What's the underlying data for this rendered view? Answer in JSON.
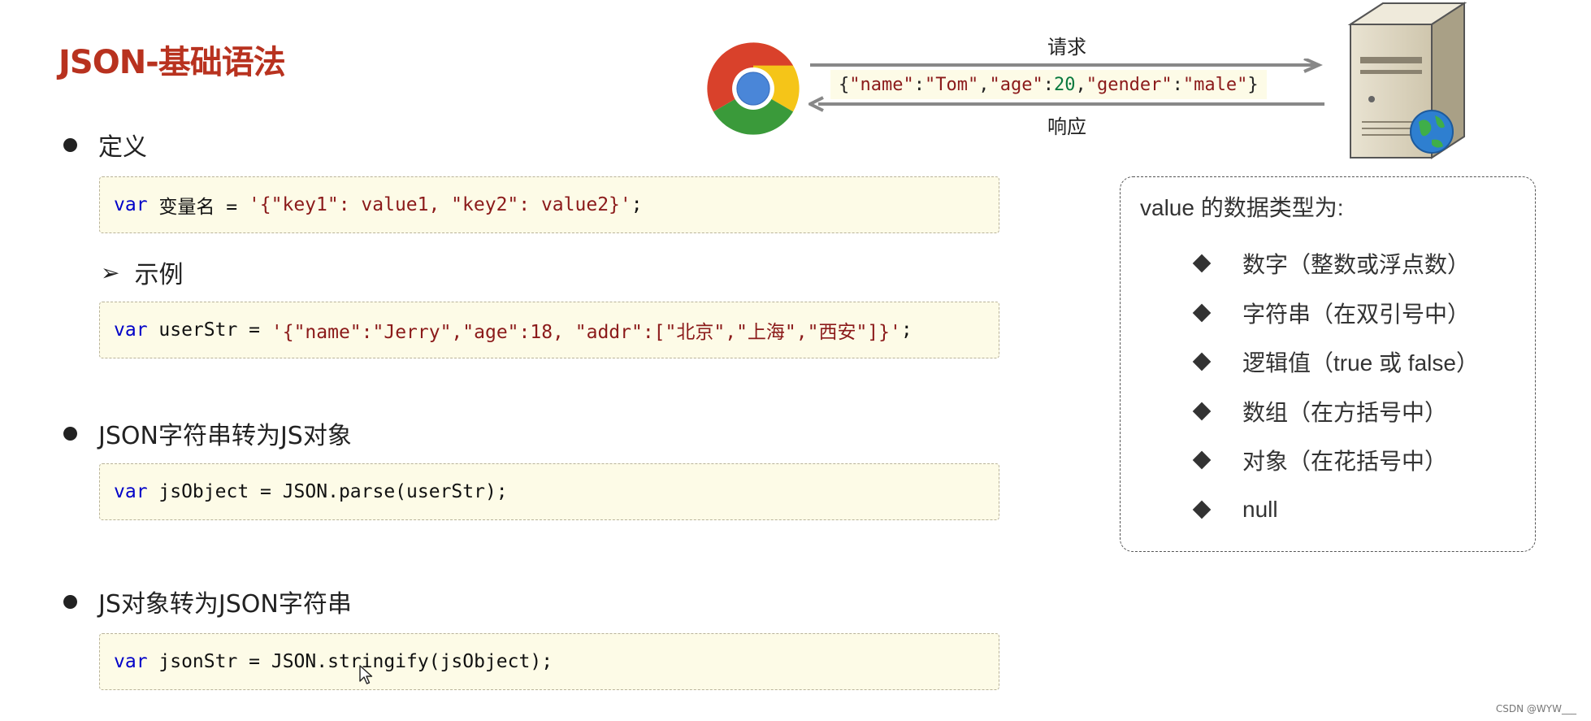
{
  "title": "JSON-基础语法",
  "sections": {
    "definition": "定义",
    "example": "示例",
    "parse": "JSON字符串转为JS对象",
    "stringify": "JS对象转为JSON字符串"
  },
  "code": {
    "definition": {
      "kw": "var",
      "pre": " 变量名 = ",
      "str": "'{\"key1\": value1, \"key2\": value2}'",
      "post": ";"
    },
    "example": {
      "kw": "var",
      "pre": " userStr = ",
      "str1": "'{\"name\":\"Jerry\",\"age\":18, \"addr\":[\"北京\",\"上海\",\"西安\"]}'",
      "post": ";"
    },
    "parse": {
      "kw": "var",
      "rest": " jsObject = JSON.parse(userStr);"
    },
    "stringify": {
      "kw": "var",
      "rest": " jsonStr = JSON.stringify(jsObject);"
    }
  },
  "diagram": {
    "request_label": "请求",
    "response_label": "响应",
    "json_open": "{",
    "json_k1": "\"name\"",
    "json_c1": ":",
    "json_v1": "\"Tom\"",
    "json_sep1": ",",
    "json_k2": "\"age\"",
    "json_c2": ":",
    "json_v2": "20",
    "json_sep2": ",",
    "json_k3": "\"gender\"",
    "json_c3": ":",
    "json_v3": "\"male\"",
    "json_close": "}",
    "colors": {
      "arrow": "#888888",
      "string": "#8b1a1a",
      "number": "#097a3e"
    }
  },
  "value_types": {
    "title": "value 的数据类型为:",
    "items": [
      "数字（整数或浮点数）",
      "字符串（在双引号中）",
      "逻辑值（true 或 false）",
      "数组（在方括号中）",
      "对象（在花括号中）",
      "null"
    ]
  },
  "watermark": "CSDN @WYW___",
  "colors": {
    "title": "#b8321f",
    "code_bg": "#fdfbe7",
    "keyword": "#0000c8"
  }
}
